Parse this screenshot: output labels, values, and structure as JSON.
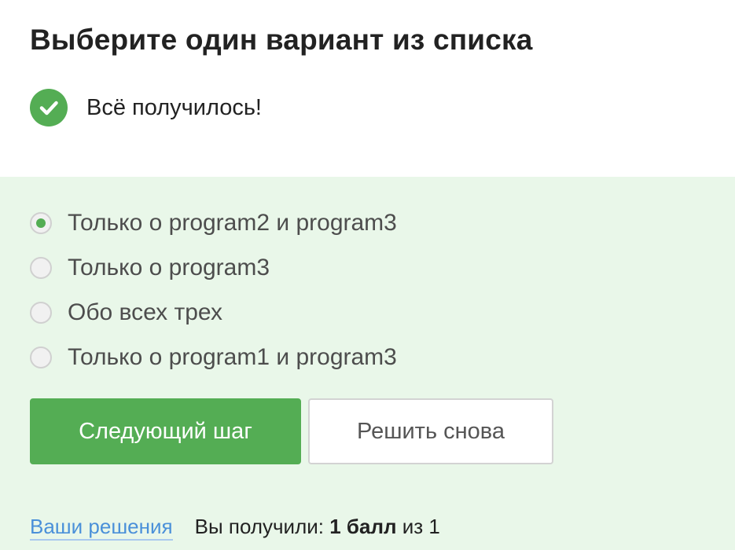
{
  "task": {
    "title": "Выберите один вариант из списка"
  },
  "status": {
    "text": "Всё получилось!",
    "icon": "checkmark-icon",
    "color": "#54ad54"
  },
  "options": [
    {
      "label": "Только о program2 и program3",
      "selected": true
    },
    {
      "label": "Только о program3",
      "selected": false
    },
    {
      "label": "Обо всех трех",
      "selected": false
    },
    {
      "label": "Только о program1 и program3",
      "selected": false
    }
  ],
  "buttons": {
    "next_label": "Следующий шаг",
    "retry_label": "Решить снова"
  },
  "footer": {
    "solutions_link": "Ваши решения",
    "score_prefix": "Вы получили:",
    "score_value": "1 балл",
    "score_suffix": "из 1"
  },
  "colors": {
    "accent": "#54ad54",
    "answer_background": "#e9f7e9",
    "link": "#4a90d9"
  }
}
